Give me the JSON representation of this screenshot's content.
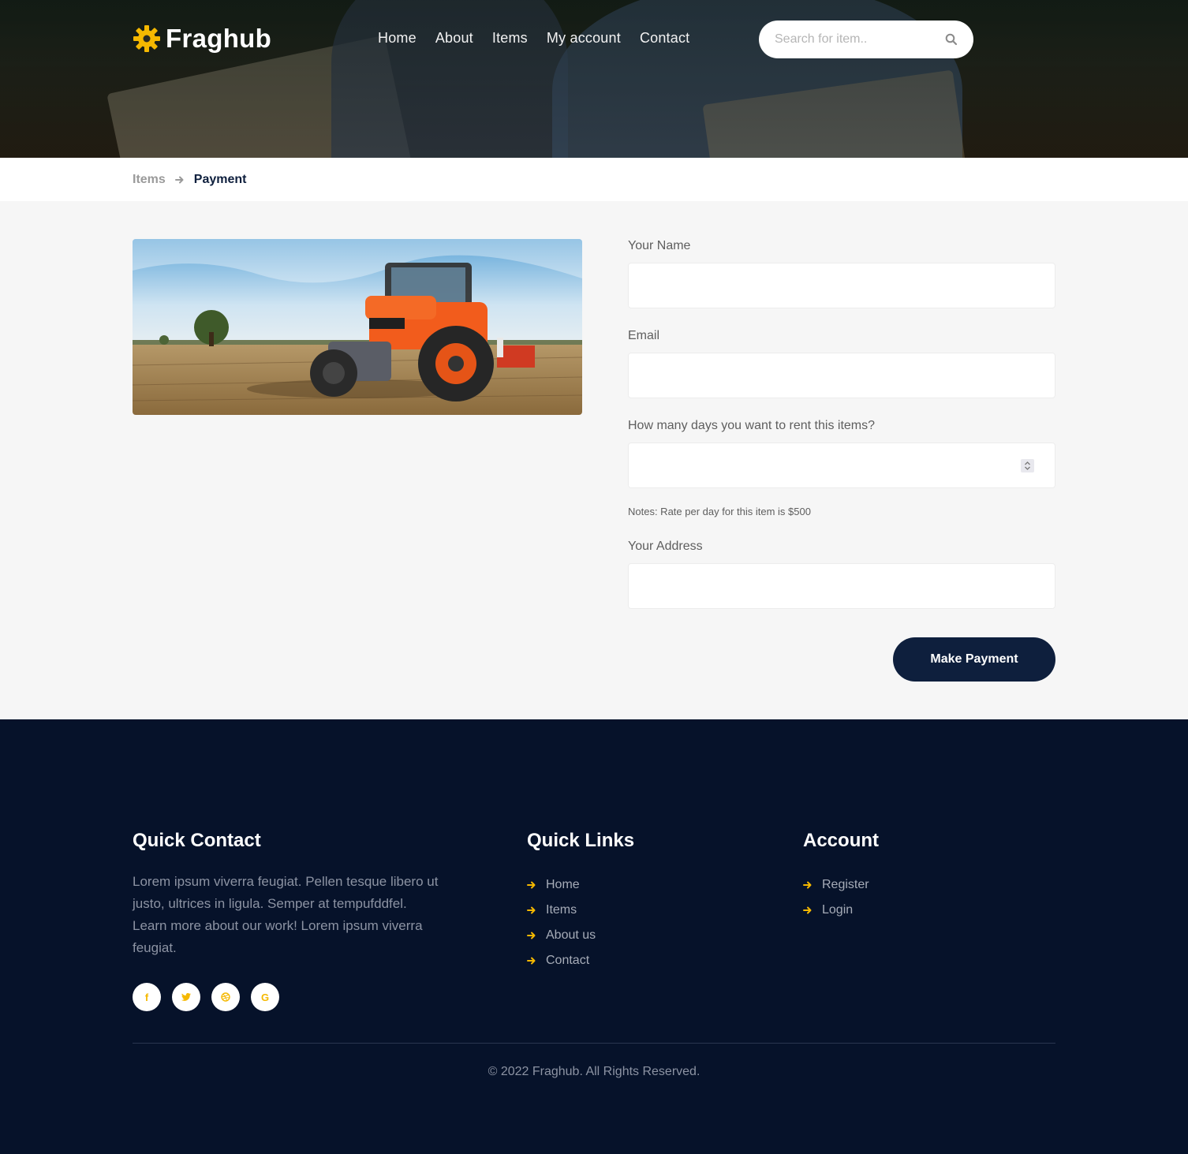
{
  "header": {
    "logo_text": "Fraghub",
    "nav": [
      "Home",
      "About",
      "Items",
      "My account",
      "Contact"
    ],
    "search_placeholder": "Search for item.."
  },
  "breadcrumb": {
    "parent": "Items",
    "current": "Payment"
  },
  "form": {
    "name_label": "Your Name",
    "email_label": "Email",
    "days_label": "How many days you want to rent this items?",
    "note": "Notes: Rate per day for this item is $500",
    "address_label": "Your Address",
    "submit_label": "Make Payment"
  },
  "footer": {
    "contact_title": "Quick Contact",
    "contact_text": "Lorem ipsum viverra feugiat. Pellen tesque libero ut justo, ultrices in ligula. Semper at tempufddfel. Learn more about our work! Lorem ipsum viverra feugiat.",
    "socials": [
      "f",
      "t",
      "d",
      "G"
    ],
    "links_title": "Quick Links",
    "links": [
      "Home",
      "Items",
      "About us",
      "Contact"
    ],
    "account_title": "Account",
    "account_links": [
      "Register",
      "Login"
    ],
    "copyright": "© 2022 Fraghub. All Rights Reserved."
  },
  "colors": {
    "accent": "#f5b800",
    "navy": "#0e1f3d",
    "footer_bg": "#06122a"
  },
  "icons": {
    "logo": "gear-icon",
    "search": "search-icon",
    "breadcrumb_arrow": "arrow-right-icon",
    "link_arrow": "arrow-right-icon",
    "socials": [
      "facebook-icon",
      "twitter-icon",
      "dribbble-icon",
      "google-icon"
    ]
  }
}
